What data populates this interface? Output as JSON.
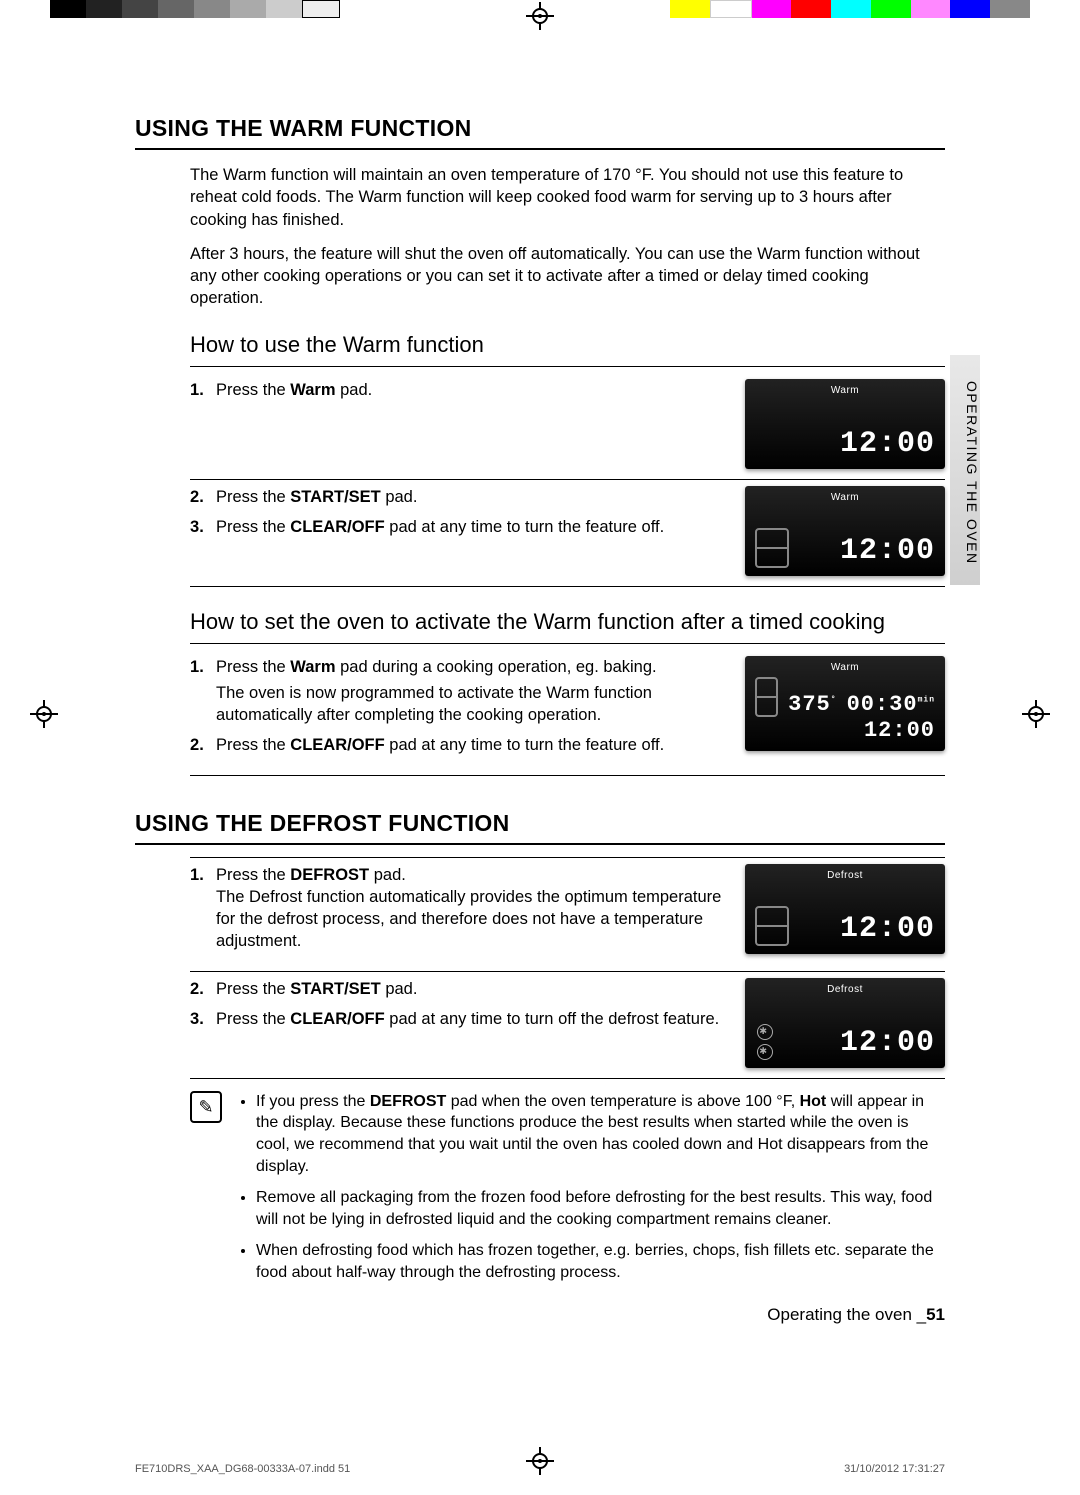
{
  "tab": "OPERATING THE OVEN",
  "section_warm": {
    "title": "USING THE WARM FUNCTION",
    "intro1": "The Warm function will maintain an oven temperature of 170 °F. You should not use this feature to reheat cold foods. The Warm function will keep cooked food warm for serving up to 3 hours after cooking has finished.",
    "intro2": "After 3 hours, the feature will shut the oven off automatically. You can use the Warm function without any other cooking operations or you can set it to activate after a timed or delay timed cooking operation.",
    "h2a": "How to use the Warm function",
    "step1a_pre": "Press the ",
    "step1a_b": "Warm",
    "step1a_post": " pad.",
    "step2a_pre": "Press the ",
    "step2a_b": "START/SET",
    "step2a_post": " pad.",
    "step3a_pre": "Press the ",
    "step3a_b": "CLEAR/OFF",
    "step3a_post": " pad at any time to turn the feature off.",
    "h2b": "How to set the oven to activate the Warm function after a timed cooking",
    "step1b_pre": "Press the ",
    "step1b_b": "Warm",
    "step1b_post": " pad during a cooking operation, eg. baking.",
    "step1b_sub": "The oven is now programmed to activate the Warm function automatically after completing the cooking operation.",
    "step2b_pre": "Press the ",
    "step2b_b": "CLEAR/OFF",
    "step2b_post": " pad at any time to turn the feature off."
  },
  "section_defrost": {
    "title": "USING THE DEFROST FUNCTION",
    "step1_pre": "Press the ",
    "step1_b": "DEFROST",
    "step1_post": " pad.",
    "step1_sub": "The Defrost function automatically provides the optimum temperature for the defrost process, and therefore does not have a temperature adjustment.",
    "step2_pre": "Press the ",
    "step2_b": "START/SET",
    "step2_post": " pad.",
    "step3_pre": "Press the ",
    "step3_b": "CLEAR/OFF",
    "step3_post": " pad at any time to turn off the defrost feature."
  },
  "note": {
    "b1_pre": "If you press the ",
    "b1_b1": "DEFROST",
    "b1_mid": " pad when the oven temperature is above 100 °F, ",
    "b1_b2": "Hot",
    "b1_post": " will appear in the display. Because these functions produce the best results when started while the oven is cool, we recommend that you wait until the oven has cooled down and Hot disappears from the display.",
    "b2": "Remove all packaging from the frozen food before defrosting for the best results. This way, food will not be lying in defrosted liquid and the cooking compartment remains cleaner.",
    "b3": "When defrosting food which has frozen together, e.g. berries, chops, fish fillets etc. separate the food about half-way through the defrosting process."
  },
  "displays": {
    "warm_label": "Warm",
    "defrost_label": "Defrost",
    "clock": "12:00",
    "temp": "375",
    "deg": "°",
    "timer": "00:30",
    "timer_unit": "min"
  },
  "footer": {
    "running": "Operating the oven _",
    "page": "51",
    "file": "FE710DRS_XAA_DG68-00333A-07.indd   51",
    "stamp": "31/10/2012   17:31:27"
  }
}
